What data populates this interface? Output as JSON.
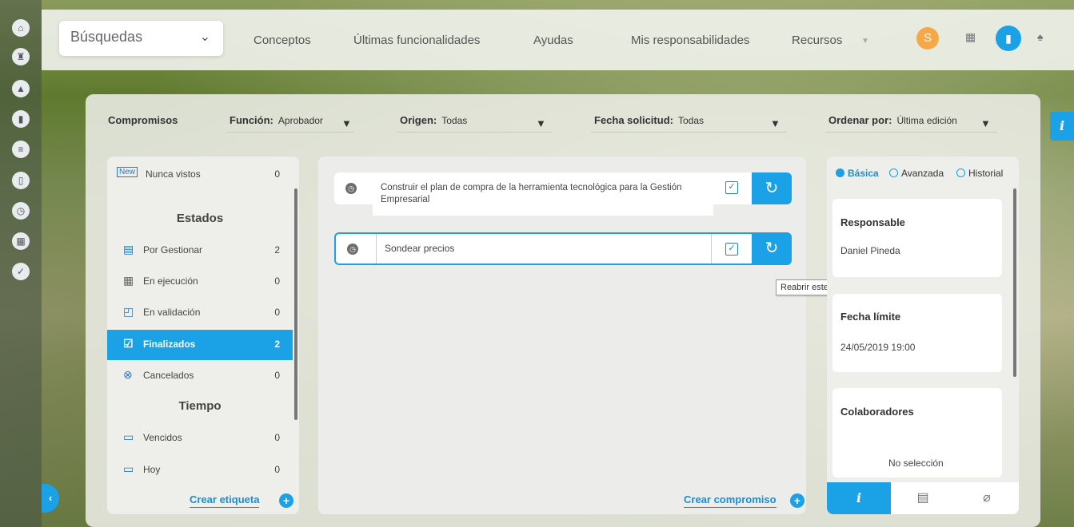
{
  "colors": {
    "accent": "#1aa1e6",
    "avatar": "#f5a847",
    "active_bg": "#1aa1e6"
  },
  "left_rail": {
    "icons": [
      "home-icon",
      "tower-icon",
      "mountain-icon",
      "chart-icon",
      "menu-icon",
      "book-icon",
      "clock-icon",
      "calendar-icon",
      "check-circle-icon"
    ]
  },
  "topbar": {
    "search_label": "Búsquedas",
    "nav": [
      "Conceptos",
      "Últimas funcionalidades",
      "Ayudas",
      "Mis responsabilidades",
      "Recursos"
    ],
    "avatar_letter": "S"
  },
  "filters": {
    "title": "Compromisos",
    "funcion_label": "Función:",
    "funcion_value": "Aprobador",
    "origen_label": "Origen:",
    "origen_value": "Todas",
    "fecha_label": "Fecha solicitud:",
    "fecha_value": "Todas",
    "ordenar_label": "Ordenar por:",
    "ordenar_value": "Última edición"
  },
  "left": {
    "new_badge": "New",
    "nunca_label": "Nunca vistos",
    "nunca_count": "0",
    "estados_title": "Estados",
    "estados": [
      {
        "label": "Por Gestionar",
        "count": "2"
      },
      {
        "label": "En ejecución",
        "count": "0"
      },
      {
        "label": "En validación",
        "count": "0"
      },
      {
        "label": "Finalizados",
        "count": "2"
      },
      {
        "label": "Cancelados",
        "count": "0"
      }
    ],
    "tiempo_title": "Tiempo",
    "tiempo": [
      {
        "label": "Vencidos",
        "count": "0"
      },
      {
        "label": "Hoy",
        "count": "0"
      }
    ],
    "create_tag": "Crear etiqueta"
  },
  "mid": {
    "items": [
      {
        "text": "Construir el plan de compra de la herramienta tecnológica para la Gestión Empresarial"
      },
      {
        "text": "Sondear precios"
      }
    ],
    "tooltip": "Reabrir este compromiso",
    "create": "Crear compromiso"
  },
  "right": {
    "radios": [
      "Básica",
      "Avanzada",
      "Historial"
    ],
    "responsable_label": "Responsable",
    "responsable_value": "Daniel Pineda",
    "fecha_label": "Fecha límite",
    "fecha_value": "24/05/2019 19:00",
    "colab_label": "Colaboradores",
    "colab_value": "No selección"
  }
}
